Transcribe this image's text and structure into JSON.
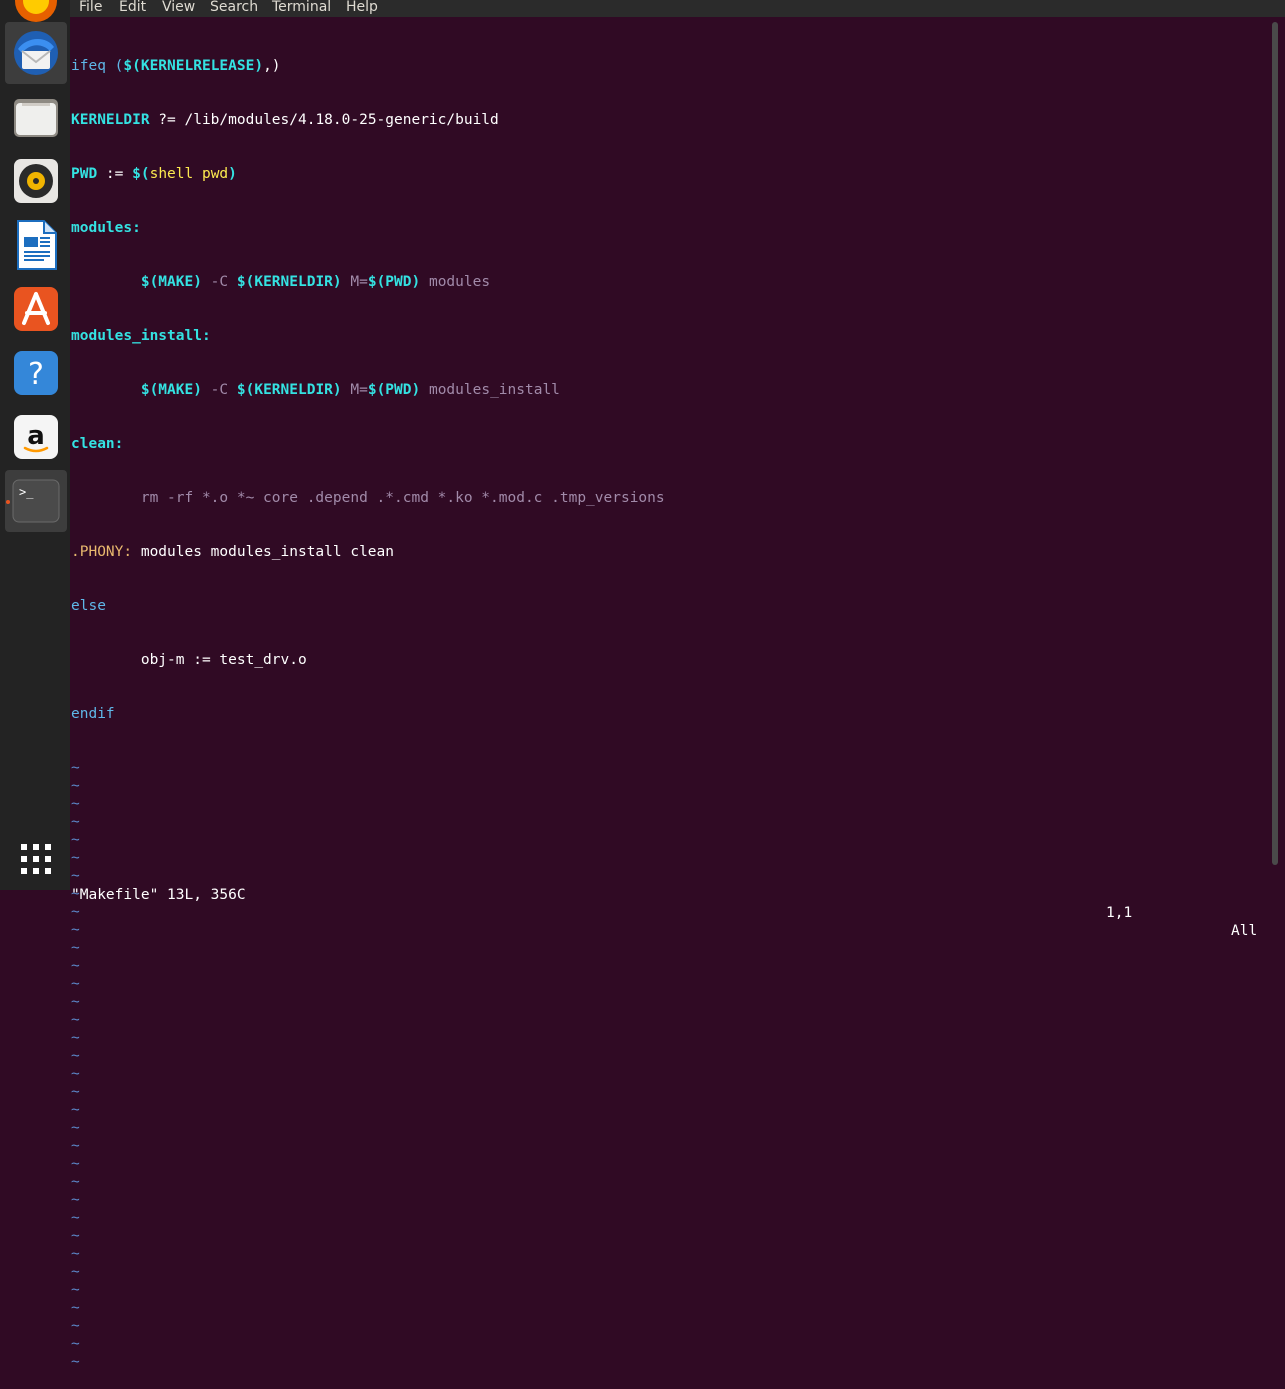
{
  "menubar": {
    "items": [
      "File",
      "Edit",
      "View",
      "Search",
      "Terminal",
      "Help"
    ]
  },
  "dock": {
    "apps": [
      {
        "name": "firefox-icon"
      },
      {
        "name": "thunderbird-icon"
      },
      {
        "name": "files-icon"
      },
      {
        "name": "rhythmbox-icon"
      },
      {
        "name": "libreoffice-writer-icon"
      },
      {
        "name": "ubuntu-software-icon"
      },
      {
        "name": "help-icon"
      },
      {
        "name": "amazon-icon"
      },
      {
        "name": "terminal-icon"
      }
    ],
    "help_glyph": "?",
    "amazon_glyph": "a",
    "terminal_glyph": ">_"
  },
  "editor": {
    "lines": [
      [
        "ifeq (",
        "$(KERNELRELEASE)",
        ",)"
      ],
      [
        "KERNELDIR",
        " ?= /lib/modules/4.18.0-25-generic/build"
      ],
      [
        "PWD",
        " := ",
        "$(",
        "shell pwd",
        ")"
      ],
      [
        "modules:"
      ],
      [
        "        ",
        "$(MAKE)",
        " -C ",
        "$(KERNELDIR)",
        " M=",
        "$(PWD)",
        " modules"
      ],
      [
        "modules_install:"
      ],
      [
        "        ",
        "$(MAKE)",
        " -C ",
        "$(KERNELDIR)",
        " M=",
        "$(PWD)",
        " modules_install"
      ],
      [
        "clean:"
      ],
      [
        "        rm -rf *.o *~ core .depend .*.cmd *.ko *.mod.c .tmp_versions"
      ],
      [
        ".PHONY:",
        " modules modules_install clean"
      ],
      [
        "else"
      ],
      [
        "        obj-m := test_drv.o"
      ],
      [
        "endif"
      ]
    ],
    "tilde": "~",
    "tilde_count": 34
  },
  "status": {
    "message": "\"Makefile\" 13L, 356C",
    "position": "1,1",
    "scroll": "All"
  },
  "colors": {
    "background": "#300a24",
    "keyword": "#5fb7e8",
    "variable": "#34e2e2",
    "command": "#a18aa9",
    "tilde": "#5b88c9",
    "accent": "#e95420"
  }
}
